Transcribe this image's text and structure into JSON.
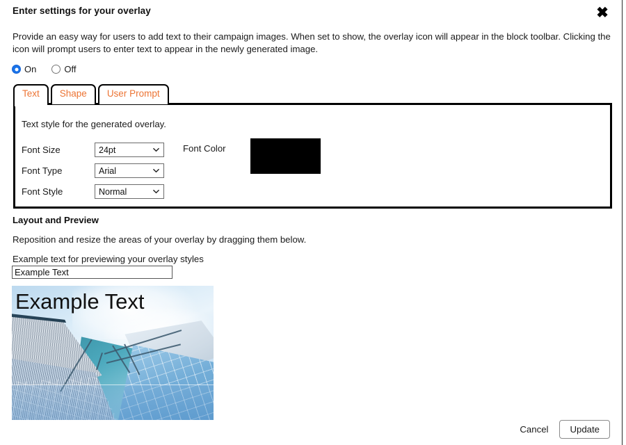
{
  "dialog": {
    "title": "Enter settings for your overlay",
    "close_icon": "close-icon",
    "description": "Provide an easy way for users to add text to their campaign images. When set to show, the overlay icon will appear in the block toolbar. Clicking the icon will prompt users to enter text to appear in the newly generated image."
  },
  "toggle": {
    "on_label": "On",
    "off_label": "Off",
    "selected": "On",
    "accent_color": "#1a73e8"
  },
  "tabs": {
    "active": "Text",
    "accent_color": "#ec7434",
    "items": [
      {
        "label": "Text"
      },
      {
        "label": "Shape"
      },
      {
        "label": "User Prompt"
      }
    ]
  },
  "text_panel": {
    "caption": "Text style for the generated overlay.",
    "fields": [
      {
        "label": "Font Size",
        "value": "24pt"
      },
      {
        "label": "Font Type",
        "value": "Arial"
      },
      {
        "label": "Font Style",
        "value": "Normal"
      }
    ],
    "font_color": {
      "label": "Font Color",
      "value": "#000000"
    }
  },
  "layout": {
    "section_title": "Layout and Preview",
    "section_subtitle": "Reposition and resize the areas of your overlay by dragging them below.",
    "example_caption": "Example text for previewing your overlay styles",
    "example_value": "Example Text",
    "example_placeholder": "Example Text",
    "preview_overlay_text": "Example Text"
  },
  "footer": {
    "cancel_label": "Cancel",
    "update_label": "Update"
  }
}
